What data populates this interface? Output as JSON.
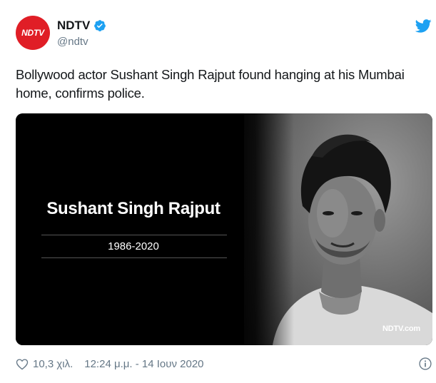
{
  "account": {
    "display_name": "NDTV",
    "handle": "@ndtv",
    "avatar_text": "NDTV",
    "verified": true
  },
  "tweet": {
    "text": "Bollywood actor Sushant Singh Rajput found hanging at his Mumbai home, confirms police."
  },
  "media": {
    "memorial_name": "Sushant Singh Rajput",
    "years": "1986-2020",
    "watermark": "NDTV.com"
  },
  "footer": {
    "likes": "10,3 χιλ.",
    "timestamp": "12:24 μ.μ. - 14 Ιουν 2020"
  },
  "colors": {
    "brand_red": "#e01e26",
    "twitter_blue": "#1da1f2",
    "muted_text": "#657786"
  },
  "icons": [
    "verified-badge-icon",
    "twitter-bird-icon",
    "heart-icon",
    "info-icon"
  ]
}
